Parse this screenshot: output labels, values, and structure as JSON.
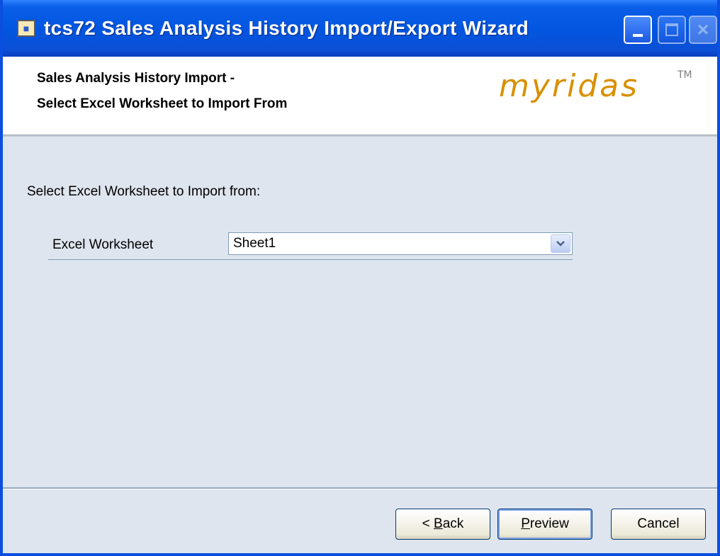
{
  "window": {
    "title": "tcs72 Sales Analysis History Import/Export Wizard"
  },
  "header": {
    "title_line1": "Sales Analysis History Import -",
    "title_line2": "Select Excel Worksheet to Import From",
    "logo_text": "myridas",
    "logo_tm": "TM",
    "logo_color": "#d99000"
  },
  "content": {
    "instruction": "Select Excel Worksheet to Import from:",
    "worksheet_field": {
      "label": "Excel Worksheet",
      "value": "Sheet1"
    }
  },
  "buttons": {
    "back": {
      "prefix": "< ",
      "accel": "B",
      "rest": "ack"
    },
    "preview": {
      "accel": "P",
      "rest": "review"
    },
    "cancel": {
      "label": "Cancel"
    }
  },
  "icons": {
    "app": "wizard-app-icon",
    "dropdown": "chevron-down-icon"
  }
}
